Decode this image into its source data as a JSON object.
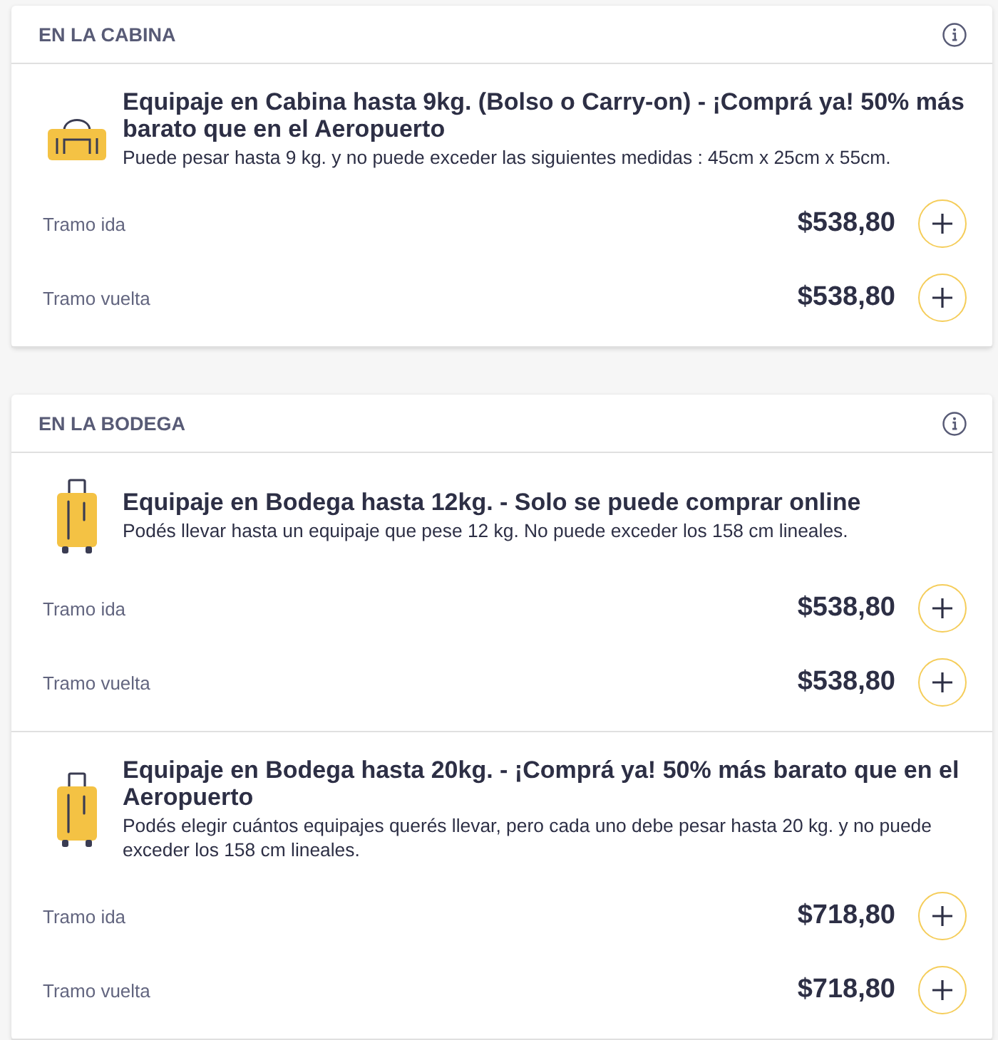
{
  "sections": [
    {
      "title": "EN LA CABINA",
      "items": [
        {
          "kind": "cabin_bag",
          "title": "Equipaje en Cabina hasta 9kg. (Bolso o Carry-on) - ¡Comprá ya! 50% más barato que en el Aeropuerto",
          "description": "Puede pesar hasta 9 kg. y no puede exceder las siguientes medidas : 45cm x 25cm x 55cm.",
          "segments": [
            {
              "label": "Tramo ida",
              "price": "$538,80"
            },
            {
              "label": "Tramo vuelta",
              "price": "$538,80"
            }
          ]
        }
      ]
    },
    {
      "title": "EN LA BODEGA",
      "items": [
        {
          "kind": "suitcase",
          "title": "Equipaje en Bodega hasta 12kg. - Solo se puede comprar online",
          "description": "Podés llevar hasta un equipaje que pese 12 kg. No puede exceder los 158 cm lineales.",
          "segments": [
            {
              "label": "Tramo ida",
              "price": "$538,80"
            },
            {
              "label": "Tramo vuelta",
              "price": "$538,80"
            }
          ]
        },
        {
          "kind": "suitcase",
          "title": "Equipaje en Bodega hasta 20kg. - ¡Comprá ya! 50% más barato que en el Aeropuerto",
          "description": "Podés elegir cuántos equipajes querés llevar, pero cada uno debe pesar hasta 20 kg. y no puede exceder los 158 cm lineales.",
          "segments": [
            {
              "label": "Tramo ida",
              "price": "$718,80"
            },
            {
              "label": "Tramo vuelta",
              "price": "$718,80"
            }
          ]
        }
      ]
    }
  ]
}
